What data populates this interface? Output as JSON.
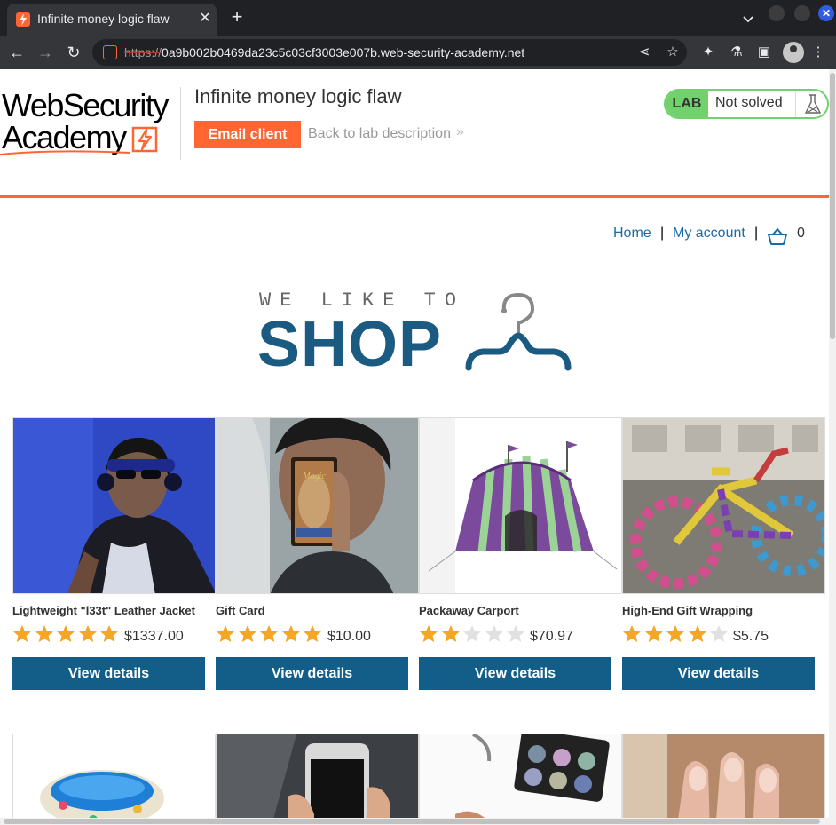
{
  "browser": {
    "tab_title": "Infinite money logic flaw",
    "url_scheme": "https://",
    "url_rest": "0a9b002b0469da23c5c03cf3003e007b.web-security-academy.net"
  },
  "header": {
    "logo_line1": "WebSecurity",
    "logo_line2": "Academy",
    "lab_title": "Infinite money logic flaw",
    "email_client_label": "Email client",
    "back_link_label": "Back to lab description",
    "back_chevron": "»",
    "lab_badge": "LAB",
    "lab_status": "Not solved"
  },
  "nav": {
    "home": "Home",
    "separator": "|",
    "my_account": "My account",
    "cart_count": "0"
  },
  "banner": {
    "tagline": "WE LIKE TO",
    "word": "SHOP"
  },
  "colors": {
    "brand_orange": "#ff6633",
    "button_blue": "#135e88",
    "link_blue": "#1a6ca8",
    "lab_green": "#70d16d",
    "star_gold": "#f5a623",
    "star_empty": "#e1e1e1"
  },
  "products": [
    {
      "name": "Lightweight \"l33t\" Leather Jacket",
      "price": "$1337.00",
      "rating": 5,
      "button": "View details"
    },
    {
      "name": "Gift Card",
      "price": "$10.00",
      "rating": 5,
      "button": "View details"
    },
    {
      "name": "Packaway Carport",
      "price": "$70.97",
      "rating": 2,
      "button": "View details"
    },
    {
      "name": "High-End Gift Wrapping",
      "price": "$5.75",
      "rating": 4,
      "button": "View details"
    }
  ],
  "icons": {
    "cart": "basket-icon",
    "flask": "flask-icon",
    "share": "share-icon",
    "bookmark": "star-icon",
    "extensions": "puzzle-icon",
    "labs": "beaker-icon",
    "sidepanel": "side-panel-icon",
    "menu": "kebab-menu-icon"
  }
}
